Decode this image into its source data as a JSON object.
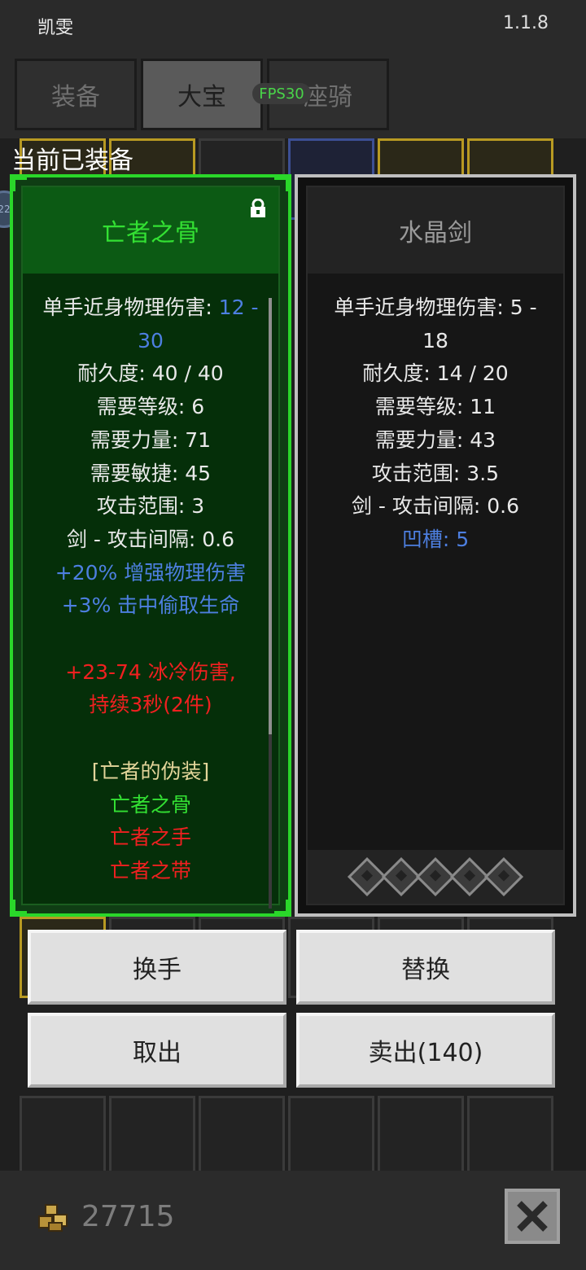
{
  "app": {
    "name": "凯雯",
    "version": "1.1.8"
  },
  "tabs": [
    {
      "label": "装备",
      "active": false
    },
    {
      "label": "大宝",
      "active": true
    },
    {
      "label": "座骑",
      "active": false
    }
  ],
  "fps": "FPS30",
  "equipped_label": "当前已装备",
  "avatar_badge": "22",
  "left_item": {
    "name": "亡者之骨",
    "lines": [
      {
        "text": "单手近身物理伤害: ",
        "extra": "12 -",
        "color": "white"
      },
      {
        "text": "30",
        "color": "blue"
      },
      {
        "text": "耐久度: 40 / 40",
        "color": "white"
      },
      {
        "text": "需要等级: 6",
        "color": "white"
      },
      {
        "text": "需要力量: 71",
        "color": "white"
      },
      {
        "text": "需要敏捷: 45",
        "color": "white"
      },
      {
        "text": "攻击范围: 3",
        "color": "white"
      },
      {
        "text": "剑 - 攻击间隔: 0.6",
        "color": "white"
      },
      {
        "text": "+20% 增强物理伤害",
        "color": "blue"
      },
      {
        "text": "+3% 击中偷取生命",
        "color": "blue"
      },
      {
        "text": "",
        "color": "white"
      },
      {
        "text": "+23-74 冰冷伤害,",
        "color": "red"
      },
      {
        "text": "持续3秒(2件)",
        "color": "red"
      },
      {
        "text": "",
        "color": "white"
      },
      {
        "text": "[亡者的伪装]",
        "color": "tan"
      },
      {
        "text": "亡者之骨",
        "color": "green"
      },
      {
        "text": "亡者之手",
        "color": "red"
      },
      {
        "text": "亡者之带",
        "color": "red"
      }
    ]
  },
  "right_item": {
    "name": "水晶剑",
    "lines": [
      {
        "text": "单手近身物理伤害: 5 -",
        "color": "white"
      },
      {
        "text": "18",
        "color": "white"
      },
      {
        "text": "耐久度: 14 / 20",
        "color": "white"
      },
      {
        "text": "需要等级: 11",
        "color": "white"
      },
      {
        "text": "需要力量: 43",
        "color": "white"
      },
      {
        "text": "攻击范围: 3.5",
        "color": "white"
      },
      {
        "text": "剑 - 攻击间隔: 0.6",
        "color": "white"
      },
      {
        "text": "凹槽: 5",
        "color": "blue"
      }
    ],
    "socket_count": 5
  },
  "buttons": {
    "swap_hand": "换手",
    "replace": "替换",
    "take_out": "取出",
    "sell": "卖出(140)"
  },
  "gold": "27715",
  "icons": {
    "lock": "lock-icon",
    "coin": "coin-pile-icon",
    "close": "close-x-icon",
    "socket": "socket-gem-icon"
  }
}
